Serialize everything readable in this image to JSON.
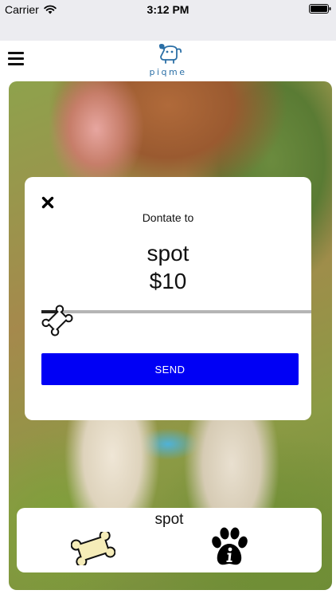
{
  "status_bar": {
    "carrier": "Carrier",
    "time": "3:12 PM",
    "icons": [
      "wifi-icon",
      "battery-icon"
    ]
  },
  "nav": {
    "logo_text": "piqme",
    "menu_icon": "hamburger-menu-icon"
  },
  "donate_modal": {
    "label": "Dontate to",
    "pet_name": "spot",
    "amount": "$10",
    "slider_fraction": 0.06,
    "send_label": "SEND",
    "send_color": "#0000f5"
  },
  "pet_card": {
    "name": "spot",
    "icons": [
      "bone-icon",
      "paw-info-icon"
    ]
  }
}
